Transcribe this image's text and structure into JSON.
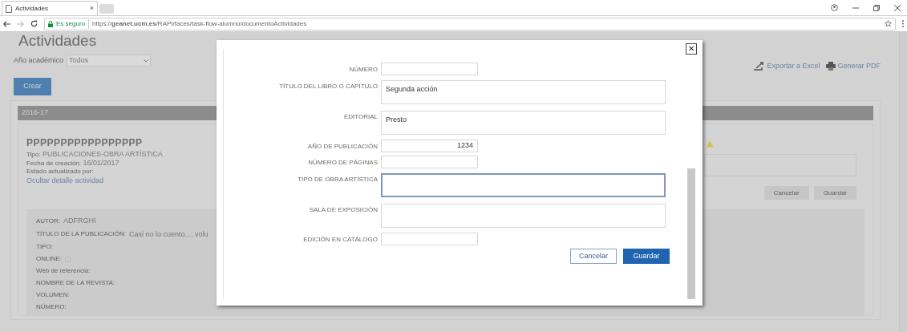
{
  "browser": {
    "tab_title": "Actividades",
    "tab_close": "×",
    "security": "Es seguro",
    "url": "https://**geanet.ucm.es**/RAPI/faces/task-flow-alumno/documentoActividades"
  },
  "page": {
    "title": "Actividades",
    "filter_label": "Año académico",
    "filter_value": "Todos",
    "create_button": "Crear",
    "actions": [
      {
        "kind": "excel",
        "label": "Exportar a Excel"
      },
      {
        "kind": "pdf",
        "label": "Generar PDF"
      }
    ],
    "section": "2016-17",
    "activity": {
      "title": "PPPPPPPPPPPPPPPPP",
      "meta": [
        {
          "label": "Tipo:",
          "value": "PUBLICACIONES-OBRA ARTÍSTICA"
        },
        {
          "label": "Fecha de creación:",
          "value": "16/01/2017"
        },
        {
          "label": "Estado actualizado por:"
        }
      ],
      "link": "Ocultar detalle actividad",
      "buttons": [
        {
          "label": "Cancelar",
          "disabled": true
        },
        {
          "label": "Guardar",
          "disabled": true
        }
      ],
      "details": [
        {
          "label": "AUTOR:",
          "value": "ADFRGHI"
        },
        {
          "label": "TÍTULO DE LA PUBLICACIÓN:",
          "value": "Casi no lo cuento.... volu"
        },
        {
          "label": "TIPO:"
        },
        {
          "label": "ONLINE:",
          "kind": "checkbox",
          "checked": false
        },
        {
          "label": "Web de referencia:"
        },
        {
          "label": "NOMBRE DE LA REVISTA:"
        },
        {
          "label": "VOLUMEN:"
        },
        {
          "label": "NÚMERO:"
        }
      ]
    }
  },
  "dialog": {
    "close": "✕",
    "fields": [
      {
        "label": "NÚMERO",
        "kind": "short",
        "focused": false
      },
      {
        "label": "TÍTULO DEL LIBRO O CAPÍTULO",
        "kind": "long",
        "value": "Segunda acción",
        "focused": false
      },
      {
        "label": "EDITORIAL",
        "kind": "long",
        "value": "Presto",
        "focused": false
      },
      {
        "label": "AÑO DE PUBLICACIÓN",
        "kind": "number",
        "value": "1234",
        "focused": false
      },
      {
        "label": "NÚMERO DE PÁGINAS",
        "kind": "short",
        "focused": false
      },
      {
        "label": "TIPO DE OBRA ARTÍSTICA",
        "kind": "long",
        "focused": true
      },
      {
        "label": "SALA DE EXPOSICIÓN",
        "kind": "long",
        "focused": false
      },
      {
        "label": "EDICIÓN EN CATÁLOGO",
        "kind": "short",
        "focused": false
      }
    ],
    "buttons": [
      {
        "label": "Cancelar",
        "kind": "secondary"
      },
      {
        "label": "Guardar",
        "kind": "primary"
      }
    ]
  }
}
